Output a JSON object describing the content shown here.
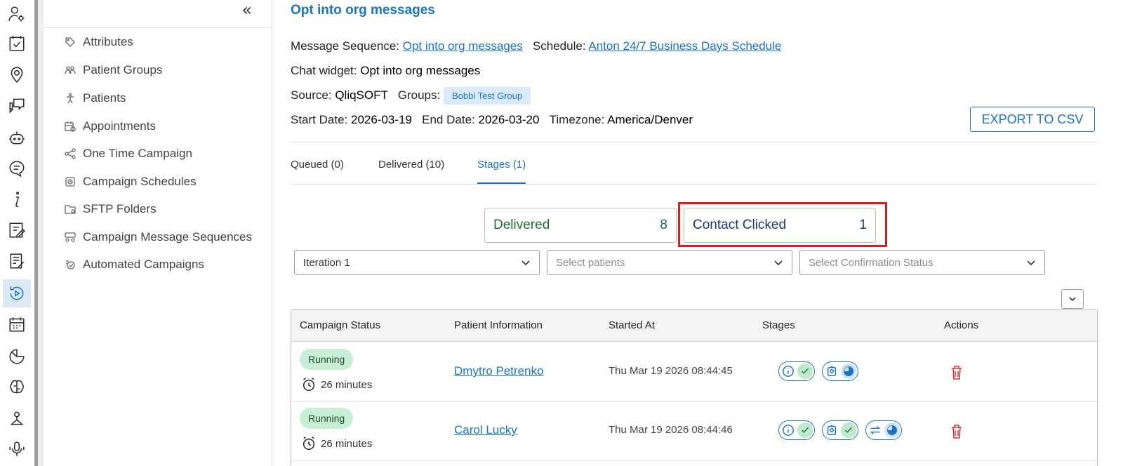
{
  "rail": {
    "icons": [
      "user-settings-icon",
      "checklist-icon",
      "location-pin-icon",
      "chat-bubbles-icon",
      "bot-icon",
      "message-list-icon",
      "info-icon",
      "document-edit-icon",
      "notes-icon",
      "campaign-play-icon",
      "calendar-grid-icon",
      "pie-chart-icon",
      "brain-icon",
      "tree-icon",
      "microphone-icon"
    ]
  },
  "sidebar": {
    "collapse_label": "«",
    "items": [
      {
        "label": "Attributes",
        "icon": "tag-icon"
      },
      {
        "label": "Patient Groups",
        "icon": "group-icon"
      },
      {
        "label": "Patients",
        "icon": "person-icon"
      },
      {
        "label": "Appointments",
        "icon": "calendar-icon"
      },
      {
        "label": "One Time Campaign",
        "icon": "share-icon"
      },
      {
        "label": "Campaign Schedules",
        "icon": "clock-icon"
      },
      {
        "label": "SFTP Folders",
        "icon": "folder-icon"
      },
      {
        "label": "Campaign Message Sequences",
        "icon": "sequence-icon"
      },
      {
        "label": "Automated Campaigns",
        "icon": "automation-icon"
      }
    ]
  },
  "main": {
    "title": "Opt into org messages",
    "meta": {
      "sequence_label": "Message Sequence:",
      "sequence_value": "Opt into org messages",
      "schedule_label": "Schedule:",
      "schedule_value": "Anton 24/7 Business Days Schedule",
      "widget_label": "Chat widget:",
      "widget_value": "Opt into org messages",
      "source_label": "Source:",
      "source_value": "QliqSOFT",
      "groups_label": "Groups:",
      "groups_chip": "Bobbi Test Group",
      "start_label": "Start Date:",
      "start_value": "2026-03-19",
      "end_label": "End Date:",
      "end_value": "2026-03-20",
      "tz_label": "Timezone:",
      "tz_value": "America/Denver"
    },
    "export_label": "EXPORT TO CSV",
    "tabs": [
      {
        "label": "Queued (0)",
        "active": false
      },
      {
        "label": "Delivered (10)",
        "active": false
      },
      {
        "label": "Stages (1)",
        "active": true
      }
    ],
    "stats": [
      {
        "label": "Delivered",
        "value": "8"
      },
      {
        "label": "Contact Clicked",
        "value": "1"
      }
    ],
    "filters": {
      "iteration": "Iteration 1",
      "patients_placeholder": "Select patients",
      "confirmation_placeholder": "Select Confirmation Status"
    },
    "table": {
      "headers": [
        "Campaign Status",
        "Patient Information",
        "Started At",
        "Stages",
        "Actions"
      ],
      "rows": [
        {
          "status": "Running",
          "duration": "26 minutes",
          "patient": "Dmytro Petrenko",
          "started": "Thu Mar 19 2026 08:44:45"
        },
        {
          "status": "Running",
          "duration": "26 minutes",
          "patient": "Carol Lucky",
          "started": "Thu Mar 19 2026 08:44:46"
        }
      ]
    }
  },
  "colors": {
    "accent": "#1a73c8",
    "running_bg": "#c8efd6",
    "highlight": "#e0191f",
    "delivered_text": "#1f6e3a"
  }
}
